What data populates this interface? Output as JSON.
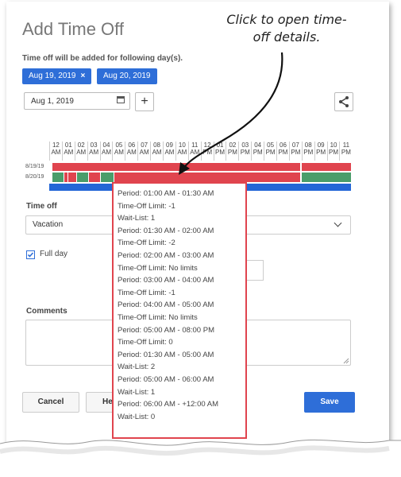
{
  "title": "Add Time Off",
  "subtitle": "Time off will be added for following day(s).",
  "chips": [
    {
      "label": "Aug 19, 2019",
      "close": "×"
    },
    {
      "label": "Aug 20, 2019"
    }
  ],
  "date_input": {
    "value": "Aug 1, 2019",
    "icon": "calendar-icon"
  },
  "plus_label": "+",
  "hours": [
    [
      "12",
      "AM"
    ],
    [
      "01",
      "AM"
    ],
    [
      "02",
      "AM"
    ],
    [
      "03",
      "AM"
    ],
    [
      "04",
      "AM"
    ],
    [
      "05",
      "AM"
    ],
    [
      "06",
      "AM"
    ],
    [
      "07",
      "AM"
    ],
    [
      "08",
      "AM"
    ],
    [
      "09",
      "AM"
    ],
    [
      "10",
      "AM"
    ],
    [
      "11",
      "AM"
    ],
    [
      "12",
      "PM"
    ],
    [
      "01",
      "PM"
    ],
    [
      "02",
      "PM"
    ],
    [
      "03",
      "PM"
    ],
    [
      "04",
      "PM"
    ],
    [
      "05",
      "PM"
    ],
    [
      "06",
      "PM"
    ],
    [
      "07",
      "PM"
    ],
    [
      "08",
      "PM"
    ],
    [
      "09",
      "PM"
    ],
    [
      "10",
      "PM"
    ],
    [
      "11",
      "PM"
    ]
  ],
  "rows": [
    "8/19/19",
    "8/20/19"
  ],
  "colors": {
    "accent": "#2e6ed8",
    "red": "#e0444e",
    "green": "#4a9d6a",
    "bar_blue": "#2466d6"
  },
  "time_off_label": "Time off",
  "time_off_value": "Vacation",
  "full_day_label": "Full day",
  "comments_label": "Comments",
  "buttons": {
    "cancel": "Cancel",
    "help": "He",
    "save": "Save"
  },
  "callout": "Click to open time-off details.",
  "popup": [
    "Period: 01:00 AM - 01:30 AM",
    "Time-Off Limit: -1",
    "Wait-List: 1",
    "Period: 01:30 AM - 02:00 AM",
    "Time-Off Limit: -2",
    "Period: 02:00 AM - 03:00 AM",
    "Time-Off Limit: No limits",
    "Period: 03:00 AM - 04:00 AM",
    "Time-Off Limit: -1",
    "Period: 04:00 AM - 05:00 AM",
    "Time-Off Limit: No limits",
    "Period: 05:00 AM - 08:00 PM",
    "Time-Off Limit: 0",
    "Period: 01:30 AM - 05:00 AM",
    "Wait-List: 2",
    "Period: 05:00 AM - 06:00 AM",
    "Wait-List: 1",
    "Period: 06:00 AM - +12:00 AM",
    "Wait-List: 0"
  ]
}
